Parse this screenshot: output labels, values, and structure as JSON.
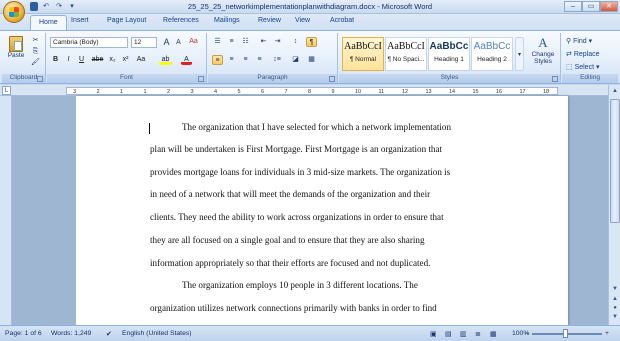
{
  "window": {
    "title": "25_25_25_networkimplementationplanwithdiagram.docx - Microsoft Word"
  },
  "qat": {
    "save": "save-icon",
    "undo": "↶",
    "redo": "↷",
    "customize": "▾"
  },
  "winbtns": {
    "minimize": "–",
    "maximize": "▭",
    "close": "✕"
  },
  "tabs": [
    "Home",
    "Insert",
    "Page Layout",
    "References",
    "Mailings",
    "Review",
    "View",
    "Acrobat"
  ],
  "clipboard": {
    "paste": "Paste",
    "group": "Clipboard"
  },
  "font": {
    "name": "Cambria (Body)",
    "size": "12",
    "group": "Font",
    "grow": "A",
    "shrink": "A",
    "clear": "Aa",
    "bold": "B",
    "italic": "I",
    "underline": "U",
    "strike": "abe",
    "sub": "x₂",
    "sup": "x²",
    "case": "Aa",
    "highlight": "ab",
    "color": "A"
  },
  "paragraph": {
    "group": "Paragraph"
  },
  "styles": {
    "group": "Styles",
    "items": [
      {
        "sample": "AaBbCcI",
        "name": "¶ Normal"
      },
      {
        "sample": "AaBbCcI",
        "name": "¶ No Spaci..."
      },
      {
        "sample": "AaBbCc",
        "name": "Heading 1"
      },
      {
        "sample": "AaBbCc",
        "name": "Heading 2"
      }
    ],
    "change": "Change Styles"
  },
  "editing": {
    "find": "Find",
    "replace": "Replace",
    "select": "Select",
    "group": "Editing"
  },
  "ruler": {
    "ticks": [
      "3",
      "2",
      "1",
      "1",
      "2",
      "3",
      "4",
      "5",
      "6",
      "7",
      "8",
      "9",
      "10",
      "11",
      "12",
      "13",
      "14",
      "15",
      "16",
      "17",
      "18"
    ]
  },
  "document": {
    "lines": [
      "The organization that I have selected for which a network implementation",
      "plan will be undertaken is First Mortgage.  First Mortgage is an organization that",
      "provides mortgage loans for individuals in 3 mid-size markets.  The organization is",
      "in need of a network that will meet the demands of the organization and their",
      "clients. They need the ability to work across organizations in order to ensure that",
      "they are all focused on a single goal and to ensure that they are also sharing",
      "information appropriately so that their efforts are focused and not duplicated.",
      "The organization employs 10 people in 3 different locations.  The",
      "organization utilizes network connections primarily with banks in order to find"
    ]
  },
  "status": {
    "page": "Page: 1 of 6",
    "words": "Words: 1,249",
    "language": "English (United States)",
    "zoom": "100%",
    "zoom_minus": "–",
    "zoom_plus": "+"
  }
}
